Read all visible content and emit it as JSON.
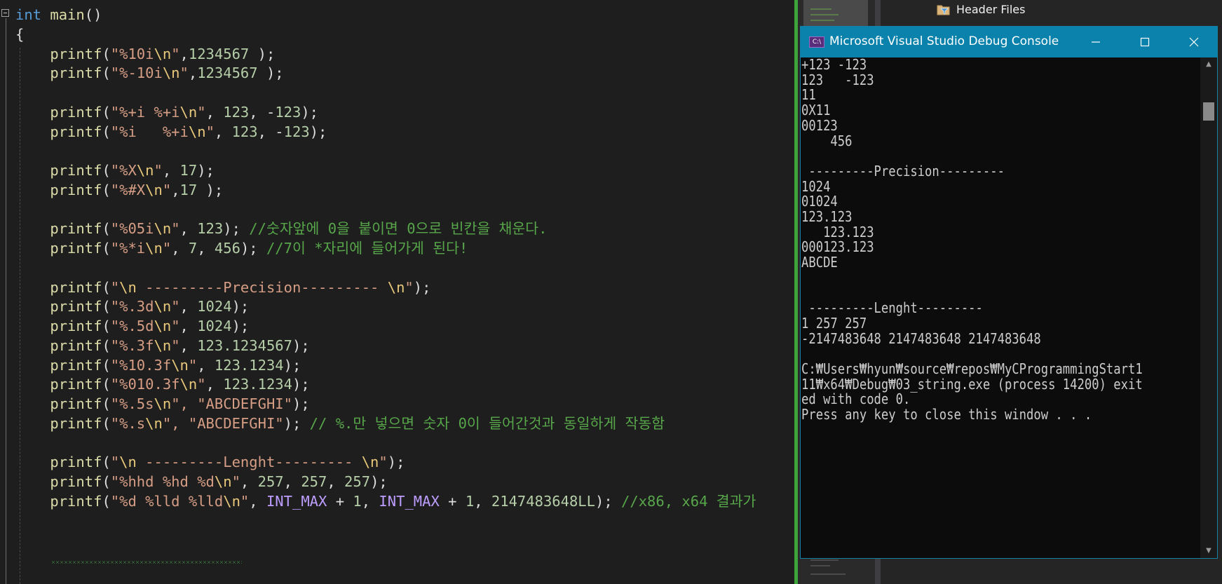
{
  "editor": {
    "lines": [
      [
        [
          "kw",
          "int"
        ],
        [
          "pl",
          " "
        ],
        [
          "fn",
          "main"
        ],
        [
          "pl",
          "()"
        ]
      ],
      [
        [
          "pl",
          "{"
        ]
      ],
      [
        [
          "pl",
          "    "
        ],
        [
          "fn",
          "printf"
        ],
        [
          "pl",
          "("
        ],
        [
          "st",
          "\"%10i"
        ],
        [
          "es",
          "\\n"
        ],
        [
          "st",
          "\""
        ],
        [
          "pl",
          ","
        ],
        [
          "nm",
          "1234567"
        ],
        [
          "pl",
          " );"
        ]
      ],
      [
        [
          "pl",
          "    "
        ],
        [
          "fn",
          "printf"
        ],
        [
          "pl",
          "("
        ],
        [
          "st",
          "\"%-10i"
        ],
        [
          "es",
          "\\n"
        ],
        [
          "st",
          "\""
        ],
        [
          "pl",
          ","
        ],
        [
          "nm",
          "1234567"
        ],
        [
          "pl",
          " );"
        ]
      ],
      [],
      [
        [
          "pl",
          "    "
        ],
        [
          "fn",
          "printf"
        ],
        [
          "pl",
          "("
        ],
        [
          "st",
          "\"%+i %+i"
        ],
        [
          "es",
          "\\n"
        ],
        [
          "st",
          "\""
        ],
        [
          "pl",
          ", "
        ],
        [
          "nm",
          "123"
        ],
        [
          "pl",
          ", -"
        ],
        [
          "nm",
          "123"
        ],
        [
          "pl",
          ");"
        ]
      ],
      [
        [
          "pl",
          "    "
        ],
        [
          "fn",
          "printf"
        ],
        [
          "pl",
          "("
        ],
        [
          "st",
          "\"%i   %+i"
        ],
        [
          "es",
          "\\n"
        ],
        [
          "st",
          "\""
        ],
        [
          "pl",
          ", "
        ],
        [
          "nm",
          "123"
        ],
        [
          "pl",
          ", -"
        ],
        [
          "nm",
          "123"
        ],
        [
          "pl",
          ");"
        ]
      ],
      [],
      [
        [
          "pl",
          "    "
        ],
        [
          "fn",
          "printf"
        ],
        [
          "pl",
          "("
        ],
        [
          "st",
          "\"%X"
        ],
        [
          "es",
          "\\n"
        ],
        [
          "st",
          "\""
        ],
        [
          "pl",
          ", "
        ],
        [
          "nm",
          "17"
        ],
        [
          "pl",
          ");"
        ]
      ],
      [
        [
          "pl",
          "    "
        ],
        [
          "fn",
          "printf"
        ],
        [
          "pl",
          "("
        ],
        [
          "st",
          "\"%#X"
        ],
        [
          "es",
          "\\n"
        ],
        [
          "st",
          "\""
        ],
        [
          "pl",
          ","
        ],
        [
          "nm",
          "17"
        ],
        [
          "pl",
          " );"
        ]
      ],
      [],
      [
        [
          "pl",
          "    "
        ],
        [
          "fn",
          "printf"
        ],
        [
          "pl",
          "("
        ],
        [
          "st",
          "\"%05i"
        ],
        [
          "es",
          "\\n"
        ],
        [
          "st",
          "\""
        ],
        [
          "pl",
          ", "
        ],
        [
          "nm",
          "123"
        ],
        [
          "pl",
          "); "
        ],
        [
          "cm",
          "//숫자앞에 0을 붙이면 0으로 빈칸을 채운다."
        ]
      ],
      [
        [
          "pl",
          "    "
        ],
        [
          "fn",
          "printf"
        ],
        [
          "pl",
          "("
        ],
        [
          "st",
          "\"%*i"
        ],
        [
          "es",
          "\\n"
        ],
        [
          "st",
          "\""
        ],
        [
          "pl",
          ", "
        ],
        [
          "nm",
          "7"
        ],
        [
          "pl",
          ", "
        ],
        [
          "nm",
          "456"
        ],
        [
          "pl",
          "); "
        ],
        [
          "cm",
          "//7이 *자리에 들어가게 된다!"
        ]
      ],
      [],
      [
        [
          "pl",
          "    "
        ],
        [
          "fn",
          "printf"
        ],
        [
          "pl",
          "("
        ],
        [
          "st",
          "\""
        ],
        [
          "es",
          "\\n"
        ],
        [
          "st",
          " ---------Precision--------- "
        ],
        [
          "es",
          "\\n"
        ],
        [
          "st",
          "\""
        ],
        [
          "pl",
          ");"
        ]
      ],
      [
        [
          "pl",
          "    "
        ],
        [
          "fn",
          "printf"
        ],
        [
          "pl",
          "("
        ],
        [
          "st",
          "\"%.3d"
        ],
        [
          "es",
          "\\n"
        ],
        [
          "st",
          "\""
        ],
        [
          "pl",
          ", "
        ],
        [
          "nm",
          "1024"
        ],
        [
          "pl",
          ");"
        ]
      ],
      [
        [
          "pl",
          "    "
        ],
        [
          "fn",
          "printf"
        ],
        [
          "pl",
          "("
        ],
        [
          "st",
          "\"%.5d"
        ],
        [
          "es",
          "\\n"
        ],
        [
          "st",
          "\""
        ],
        [
          "pl",
          ", "
        ],
        [
          "nm",
          "1024"
        ],
        [
          "pl",
          ");"
        ]
      ],
      [
        [
          "pl",
          "    "
        ],
        [
          "fn",
          "printf"
        ],
        [
          "pl",
          "("
        ],
        [
          "st",
          "\"%.3f"
        ],
        [
          "es",
          "\\n"
        ],
        [
          "st",
          "\""
        ],
        [
          "pl",
          ", "
        ],
        [
          "nm",
          "123.1234567"
        ],
        [
          "pl",
          ");"
        ]
      ],
      [
        [
          "pl",
          "    "
        ],
        [
          "fn",
          "printf"
        ],
        [
          "pl",
          "("
        ],
        [
          "st",
          "\"%10.3f"
        ],
        [
          "es",
          "\\n"
        ],
        [
          "st",
          "\""
        ],
        [
          "pl",
          ", "
        ],
        [
          "nm",
          "123.1234"
        ],
        [
          "pl",
          ");"
        ]
      ],
      [
        [
          "pl",
          "    "
        ],
        [
          "fn",
          "printf"
        ],
        [
          "pl",
          "("
        ],
        [
          "st",
          "\"%010.3f"
        ],
        [
          "es",
          "\\n"
        ],
        [
          "st",
          "\""
        ],
        [
          "pl",
          ", "
        ],
        [
          "nm",
          "123.1234"
        ],
        [
          "pl",
          ");"
        ]
      ],
      [
        [
          "pl",
          "    "
        ],
        [
          "fn",
          "printf"
        ],
        [
          "pl",
          "("
        ],
        [
          "st",
          "\"%.5s"
        ],
        [
          "es",
          "\\n"
        ],
        [
          "st",
          "\", \"ABCDEFGHI\""
        ],
        [
          "pl",
          ");"
        ]
      ],
      [
        [
          "pl",
          "    "
        ],
        [
          "fn",
          "printf"
        ],
        [
          "pl",
          "("
        ],
        [
          "st",
          "\"%.s"
        ],
        [
          "es",
          "\\n"
        ],
        [
          "st",
          "\", \"ABCDEFGHI\""
        ],
        [
          "pl",
          "); "
        ],
        [
          "cm",
          "// %.만 넣으면 숫자 0이 들어간것과 동일하게 작동함"
        ]
      ],
      [],
      [
        [
          "pl",
          "    "
        ],
        [
          "fn",
          "printf"
        ],
        [
          "pl",
          "("
        ],
        [
          "st",
          "\""
        ],
        [
          "es",
          "\\n"
        ],
        [
          "st",
          " ---------Lenght--------- "
        ],
        [
          "es",
          "\\n"
        ],
        [
          "st",
          "\""
        ],
        [
          "pl",
          ");"
        ]
      ],
      [
        [
          "pl",
          "    "
        ],
        [
          "fn",
          "printf"
        ],
        [
          "pl",
          "("
        ],
        [
          "st",
          "\"%hhd %hd %d"
        ],
        [
          "es",
          "\\n"
        ],
        [
          "st",
          "\""
        ],
        [
          "pl",
          ", "
        ],
        [
          "nm",
          "257"
        ],
        [
          "pl",
          ", "
        ],
        [
          "nm",
          "257"
        ],
        [
          "pl",
          ", "
        ],
        [
          "nm",
          "257"
        ],
        [
          "pl",
          ");"
        ]
      ],
      [
        [
          "pl",
          "    "
        ],
        [
          "fn",
          "printf"
        ],
        [
          "pl",
          "("
        ],
        [
          "st",
          "\"%d %lld %lld"
        ],
        [
          "es",
          "\\n"
        ],
        [
          "st",
          "\""
        ],
        [
          "pl",
          ", "
        ],
        [
          "mc",
          "INT_MAX"
        ],
        [
          "pl",
          " + "
        ],
        [
          "nm",
          "1"
        ],
        [
          "pl",
          ", "
        ],
        [
          "mc",
          "INT_MAX"
        ],
        [
          "pl",
          " + "
        ],
        [
          "nm",
          "1"
        ],
        [
          "pl",
          ", "
        ],
        [
          "nm",
          "2147483648LL"
        ],
        [
          "pl",
          "); "
        ],
        [
          "cm",
          "//x86, x64 결과가"
        ]
      ]
    ]
  },
  "solution_explorer": {
    "item_label": "Header Files"
  },
  "console": {
    "title": "Microsoft Visual Studio Debug Console",
    "icon_text": "C:\\",
    "icons": {
      "minimize": "minimize-icon",
      "maximize": "maximize-icon",
      "close": "close-icon"
    },
    "lines": [
      "+123 -123",
      "123   -123",
      "11",
      "0X11",
      "00123",
      "    456",
      "",
      " ---------Precision---------",
      "1024",
      "01024",
      "123.123",
      "   123.123",
      "000123.123",
      "ABCDE",
      "",
      "",
      " ---------Lenght---------",
      "1 257 257",
      "-2147483648 2147483648 2147483648",
      "",
      "C:₩Users₩hyun₩source₩repos₩MyCProgrammingStart1",
      "11₩x64₩Debug₩03_string.exe (process 14200) exit",
      "ed with code 0.",
      "Press any key to close this window . . ."
    ]
  },
  "colors": {
    "editor_bg": "#1e1e1e",
    "titlebar_bg": "#0b82ab",
    "console_bg": "#0c0c0c",
    "console_text": "#cccccc",
    "comment": "#57a64a",
    "string": "#d69d85"
  }
}
